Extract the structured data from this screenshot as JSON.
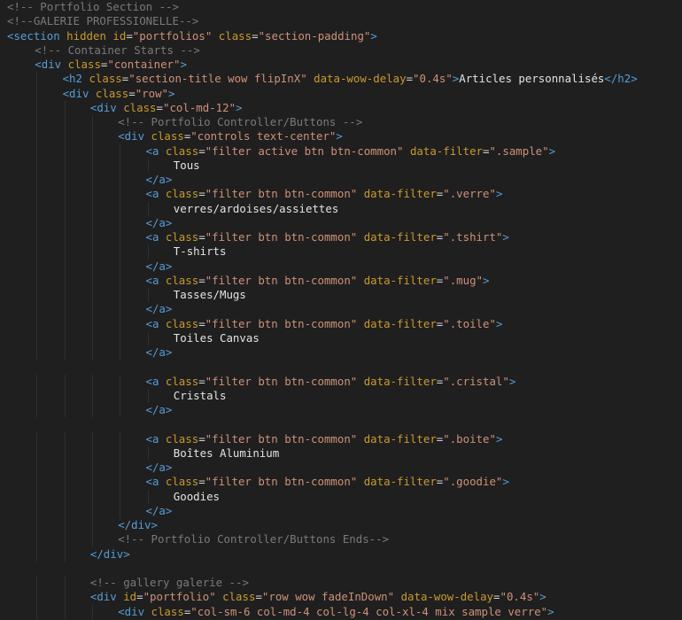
{
  "editor": {
    "lines": [
      {
        "indent": 0,
        "parts": [
          [
            "cmt",
            "<!-- Portfolio Section -->"
          ]
        ]
      },
      {
        "indent": 0,
        "parts": [
          [
            "cmt",
            "<!--GALERIE PROFESSIONELLE-->"
          ]
        ]
      },
      {
        "indent": 0,
        "parts": [
          [
            "tag",
            "<section"
          ],
          [
            "plain",
            " "
          ],
          [
            "attr",
            "hidden"
          ],
          [
            "plain",
            " "
          ],
          [
            "attr",
            "id"
          ],
          [
            "eq",
            "="
          ],
          [
            "str",
            "\"portfolios\""
          ],
          [
            "plain",
            " "
          ],
          [
            "attr",
            "class"
          ],
          [
            "eq",
            "="
          ],
          [
            "str",
            "\"section-padding\""
          ],
          [
            "tag",
            ">"
          ]
        ]
      },
      {
        "indent": 1,
        "parts": [
          [
            "cmt",
            "<!-- Container Starts -->"
          ]
        ]
      },
      {
        "indent": 1,
        "parts": [
          [
            "tag",
            "<div"
          ],
          [
            "plain",
            " "
          ],
          [
            "attr",
            "class"
          ],
          [
            "eq",
            "="
          ],
          [
            "str",
            "\"container\""
          ],
          [
            "tag",
            ">"
          ]
        ]
      },
      {
        "indent": 2,
        "parts": [
          [
            "tag",
            "<h2"
          ],
          [
            "plain",
            " "
          ],
          [
            "attr",
            "class"
          ],
          [
            "eq",
            "="
          ],
          [
            "str",
            "\"section-title wow flipInX\""
          ],
          [
            "plain",
            " "
          ],
          [
            "attr",
            "data-wow-delay"
          ],
          [
            "eq",
            "="
          ],
          [
            "str",
            "\"0.4s\""
          ],
          [
            "tag",
            ">"
          ],
          [
            "plain",
            "Articles personnalisés"
          ],
          [
            "tag",
            "</h2>"
          ]
        ]
      },
      {
        "indent": 2,
        "parts": [
          [
            "tag",
            "<div"
          ],
          [
            "plain",
            " "
          ],
          [
            "attr",
            "class"
          ],
          [
            "eq",
            "="
          ],
          [
            "str",
            "\"row\""
          ],
          [
            "tag",
            ">"
          ]
        ]
      },
      {
        "indent": 3,
        "parts": [
          [
            "tag",
            "<div"
          ],
          [
            "plain",
            " "
          ],
          [
            "attr",
            "class"
          ],
          [
            "eq",
            "="
          ],
          [
            "str",
            "\"col-md-12\""
          ],
          [
            "tag",
            ">"
          ]
        ]
      },
      {
        "indent": 4,
        "parts": [
          [
            "cmt",
            "<!-- Portfolio Controller/Buttons -->"
          ]
        ]
      },
      {
        "indent": 4,
        "parts": [
          [
            "tag",
            "<div"
          ],
          [
            "plain",
            " "
          ],
          [
            "attr",
            "class"
          ],
          [
            "eq",
            "="
          ],
          [
            "str",
            "\"controls text-center\""
          ],
          [
            "tag",
            ">"
          ]
        ]
      },
      {
        "indent": 5,
        "parts": [
          [
            "tag",
            "<a"
          ],
          [
            "plain",
            " "
          ],
          [
            "attr",
            "class"
          ],
          [
            "eq",
            "="
          ],
          [
            "str",
            "\"filter active btn btn-common\""
          ],
          [
            "plain",
            " "
          ],
          [
            "attr",
            "data-filter"
          ],
          [
            "eq",
            "="
          ],
          [
            "str",
            "\".sample\""
          ],
          [
            "tag",
            ">"
          ]
        ]
      },
      {
        "indent": 6,
        "parts": [
          [
            "plain",
            "Tous"
          ]
        ]
      },
      {
        "indent": 5,
        "parts": [
          [
            "tag",
            "</a>"
          ]
        ]
      },
      {
        "indent": 5,
        "parts": [
          [
            "tag",
            "<a"
          ],
          [
            "plain",
            " "
          ],
          [
            "attr",
            "class"
          ],
          [
            "eq",
            "="
          ],
          [
            "str",
            "\"filter btn btn-common\""
          ],
          [
            "plain",
            " "
          ],
          [
            "attr",
            "data-filter"
          ],
          [
            "eq",
            "="
          ],
          [
            "str",
            "\".verre\""
          ],
          [
            "tag",
            ">"
          ]
        ]
      },
      {
        "indent": 6,
        "parts": [
          [
            "plain",
            "verres/ardoises/assiettes"
          ]
        ]
      },
      {
        "indent": 5,
        "parts": [
          [
            "tag",
            "</a>"
          ]
        ]
      },
      {
        "indent": 5,
        "parts": [
          [
            "tag",
            "<a"
          ],
          [
            "plain",
            " "
          ],
          [
            "attr",
            "class"
          ],
          [
            "eq",
            "="
          ],
          [
            "str",
            "\"filter btn btn-common\""
          ],
          [
            "plain",
            " "
          ],
          [
            "attr",
            "data-filter"
          ],
          [
            "eq",
            "="
          ],
          [
            "str",
            "\".tshirt\""
          ],
          [
            "tag",
            ">"
          ]
        ]
      },
      {
        "indent": 6,
        "parts": [
          [
            "plain",
            "T-shirts"
          ]
        ]
      },
      {
        "indent": 5,
        "parts": [
          [
            "tag",
            "</a>"
          ]
        ]
      },
      {
        "indent": 5,
        "parts": [
          [
            "tag",
            "<a"
          ],
          [
            "plain",
            " "
          ],
          [
            "attr",
            "class"
          ],
          [
            "eq",
            "="
          ],
          [
            "str",
            "\"filter btn btn-common\""
          ],
          [
            "plain",
            " "
          ],
          [
            "attr",
            "data-filter"
          ],
          [
            "eq",
            "="
          ],
          [
            "str",
            "\".mug\""
          ],
          [
            "tag",
            ">"
          ]
        ]
      },
      {
        "indent": 6,
        "parts": [
          [
            "plain",
            "Tasses/Mugs"
          ]
        ]
      },
      {
        "indent": 5,
        "parts": [
          [
            "tag",
            "</a>"
          ]
        ]
      },
      {
        "indent": 5,
        "parts": [
          [
            "tag",
            "<a"
          ],
          [
            "plain",
            " "
          ],
          [
            "attr",
            "class"
          ],
          [
            "eq",
            "="
          ],
          [
            "str",
            "\"filter btn btn-common\""
          ],
          [
            "plain",
            " "
          ],
          [
            "attr",
            "data-filter"
          ],
          [
            "eq",
            "="
          ],
          [
            "str",
            "\".toile\""
          ],
          [
            "tag",
            ">"
          ]
        ]
      },
      {
        "indent": 6,
        "parts": [
          [
            "plain",
            "Toiles Canvas"
          ]
        ]
      },
      {
        "indent": 5,
        "parts": [
          [
            "tag",
            "</a>"
          ]
        ]
      },
      {
        "indent": 0,
        "parts": []
      },
      {
        "indent": 5,
        "parts": [
          [
            "tag",
            "<a"
          ],
          [
            "plain",
            " "
          ],
          [
            "attr",
            "class"
          ],
          [
            "eq",
            "="
          ],
          [
            "str",
            "\"filter btn btn-common\""
          ],
          [
            "plain",
            " "
          ],
          [
            "attr",
            "data-filter"
          ],
          [
            "eq",
            "="
          ],
          [
            "str",
            "\".cristal\""
          ],
          [
            "tag",
            ">"
          ]
        ]
      },
      {
        "indent": 6,
        "parts": [
          [
            "plain",
            "Cristals"
          ]
        ]
      },
      {
        "indent": 5,
        "parts": [
          [
            "tag",
            "</a>"
          ]
        ]
      },
      {
        "indent": 0,
        "parts": []
      },
      {
        "indent": 5,
        "parts": [
          [
            "tag",
            "<a"
          ],
          [
            "plain",
            " "
          ],
          [
            "attr",
            "class"
          ],
          [
            "eq",
            "="
          ],
          [
            "str",
            "\"filter btn btn-common\""
          ],
          [
            "plain",
            " "
          ],
          [
            "attr",
            "data-filter"
          ],
          [
            "eq",
            "="
          ],
          [
            "str",
            "\".boite\""
          ],
          [
            "tag",
            ">"
          ]
        ]
      },
      {
        "indent": 6,
        "parts": [
          [
            "plain",
            "Boîtes Aluminium"
          ]
        ]
      },
      {
        "indent": 5,
        "parts": [
          [
            "tag",
            "</a>"
          ]
        ]
      },
      {
        "indent": 5,
        "parts": [
          [
            "tag",
            "<a"
          ],
          [
            "plain",
            " "
          ],
          [
            "attr",
            "class"
          ],
          [
            "eq",
            "="
          ],
          [
            "str",
            "\"filter btn btn-common\""
          ],
          [
            "plain",
            " "
          ],
          [
            "attr",
            "data-filter"
          ],
          [
            "eq",
            "="
          ],
          [
            "str",
            "\".goodie\""
          ],
          [
            "tag",
            ">"
          ]
        ]
      },
      {
        "indent": 6,
        "parts": [
          [
            "plain",
            "Goodies"
          ]
        ]
      },
      {
        "indent": 5,
        "parts": [
          [
            "tag",
            "</a>"
          ]
        ]
      },
      {
        "indent": 4,
        "parts": [
          [
            "tag",
            "</div>"
          ]
        ]
      },
      {
        "indent": 4,
        "parts": [
          [
            "cmt",
            "<!-- Portfolio Controller/Buttons Ends-->"
          ]
        ]
      },
      {
        "indent": 3,
        "parts": [
          [
            "tag",
            "</div>"
          ]
        ]
      },
      {
        "indent": 0,
        "parts": []
      },
      {
        "indent": 3,
        "parts": [
          [
            "cmt",
            "<!-- gallery galerie -->"
          ]
        ]
      },
      {
        "indent": 3,
        "parts": [
          [
            "tag",
            "<div"
          ],
          [
            "plain",
            " "
          ],
          [
            "attr",
            "id"
          ],
          [
            "eq",
            "="
          ],
          [
            "str",
            "\"portfolio\""
          ],
          [
            "plain",
            " "
          ],
          [
            "attr",
            "class"
          ],
          [
            "eq",
            "="
          ],
          [
            "str",
            "\"row wow fadeInDown\""
          ],
          [
            "plain",
            " "
          ],
          [
            "attr",
            "data-wow-delay"
          ],
          [
            "eq",
            "="
          ],
          [
            "str",
            "\"0.4s\""
          ],
          [
            "tag",
            ">"
          ]
        ]
      },
      {
        "indent": 4,
        "parts": [
          [
            "tag",
            "<div"
          ],
          [
            "plain",
            " "
          ],
          [
            "attr",
            "class"
          ],
          [
            "eq",
            "="
          ],
          [
            "str",
            "\"col-sm-6 col-md-4 col-lg-4 col-xl-4 mix sample verre\""
          ],
          [
            "tag",
            ">"
          ]
        ]
      }
    ]
  }
}
